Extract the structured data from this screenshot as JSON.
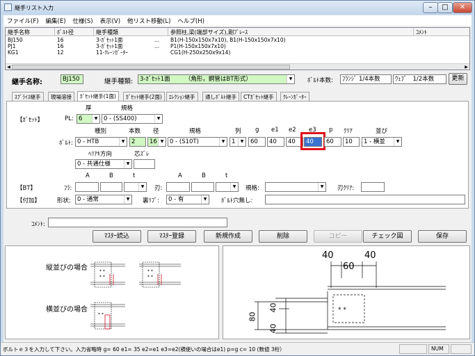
{
  "window": {
    "title": "継手リスト入力"
  },
  "menu": [
    "ファイル(F)",
    "編集(E)",
    "仕様(S)",
    "表示(V)",
    "他リスト移動(L)",
    "ヘルプ(H)"
  ],
  "list": {
    "columns": [
      "継手名称",
      "ﾎﾞﾙﾄ径",
      "継手種類",
      "参照柱,梁(端部サイズ),剛ﾌﾞﾚｰｽ",
      "ｺﾒﾝﾄ"
    ],
    "rows": [
      {
        "name": "BJ150",
        "bolt": "16",
        "type": "3-ｶﾞｾｯﾄ1面",
        "dots": "...",
        "ref": "B1(H-150x150x7x10), B1(H-150x150x7x10)"
      },
      {
        "name": "PJ1",
        "bolt": "16",
        "type": "3-ｶﾞｾｯﾄ1面",
        "dots": "...",
        "ref": "P1(H-150x150x7x10)"
      },
      {
        "name": "KG1",
        "bolt": "12",
        "type": "11-ｸﾚｰﾝｶﾞｰﾀｰ",
        "dots": "",
        "ref": "CG1(H-250x250x9x14)"
      }
    ]
  },
  "header": {
    "name_label": "継手名称:",
    "name_value": "BJ150",
    "type_label": "継手種類:",
    "type_value": "3-ｶﾞｾｯﾄ1面　　　（角形，鋼管はBT形式）",
    "bolt_count_label": "ﾎﾞﾙﾄ本数:",
    "flange_value": "ﾌﾗﾝｼﾞ 1/4本数",
    "web_value": "ｳｪﾌﾞ　1/2本数",
    "update_label": "更新"
  },
  "tabs": [
    "ｽﾌﾟﾗｲｽ継手",
    "現場溶接",
    "ｶﾞｾｯﾄ継手(1面)",
    "ｶﾞｾｯﾄ継手(2面)",
    "ｴﾚｸｼｮﾝ継手",
    "通しﾎﾞﾙﾄ継手",
    "CTｶﾞｾｯﾄ継手",
    "ｸﾚｰﾝｶﾞｰﾀｰ"
  ],
  "gusset": {
    "section_label": "【ｶﾞｾｯﾄ】",
    "thickness_header": "厚",
    "spec_header": "規格",
    "pl_label": "PL:",
    "pl_value": "6",
    "spec_value": "0 - (SS400)"
  },
  "bolt": {
    "label": "ﾎﾞﾙﾄ:",
    "headers": {
      "kind": "種別",
      "count": "本数",
      "dia": "径",
      "spec": "規格",
      "row": "列",
      "g": "g",
      "e1": "e1",
      "e2": "e2",
      "e3": "e3",
      "p": "p",
      "clear": "ｸﾘｱ",
      "arrange": "並び"
    },
    "kind": "0 - HTB",
    "count": "2",
    "dia": "16",
    "spec": "0 - (S10T)",
    "row": "1",
    "g": "60",
    "e1": "40",
    "e2": "40",
    "e3": "40",
    "p": "60",
    "clear": "10",
    "arrange": "1 - 横並"
  },
  "direction": {
    "header": "ﾍﾘｱｷ方向",
    "offset_header": "芯ｽﾞﾚ",
    "value": "0 - 共通仕様"
  },
  "bt": {
    "section_label": "【BT】",
    "flange_label": "ﾌﾗ:",
    "web_label": "刃:",
    "a": "A",
    "b": "B",
    "t": "t",
    "spec_label": "規格:",
    "clear_label": "刃ｸﾘｱ:"
  },
  "addon": {
    "section_label": "【付加】",
    "shape_label": "形状:",
    "shape_value": "0 - 通常",
    "rib_label": "裏ﾘﾌﾞ:",
    "rib_value": "0 - 有",
    "hole_label": "ﾎﾞﾙﾄ穴無し:"
  },
  "comment_label": "ｺﾒﾝﾄ:",
  "buttons": {
    "master_read": "ﾏｽﾀｰ読込",
    "master_save": "ﾏｽﾀｰ登録",
    "new": "新規作成",
    "delete": "削除",
    "copy": "コピー",
    "check": "チェック図",
    "save": "保存"
  },
  "drawing_left": {
    "vertical_label": "縦並びの場合",
    "horizontal_label": "横並びの場合"
  },
  "drawing_right": {
    "dim_40a": "40",
    "dim_40b": "40",
    "dim_60": "60",
    "dim_80": "80",
    "dim_40c": "40",
    "dim_40d": "40"
  },
  "status": {
    "message": "ボルトｅ３を入力して下さい。入力省略時 g= 60 e1= 35 e2=e1 e3=e2(横使いの場合はe1) p=g c= 10 (数値 3桁）",
    "num": "NUM"
  }
}
